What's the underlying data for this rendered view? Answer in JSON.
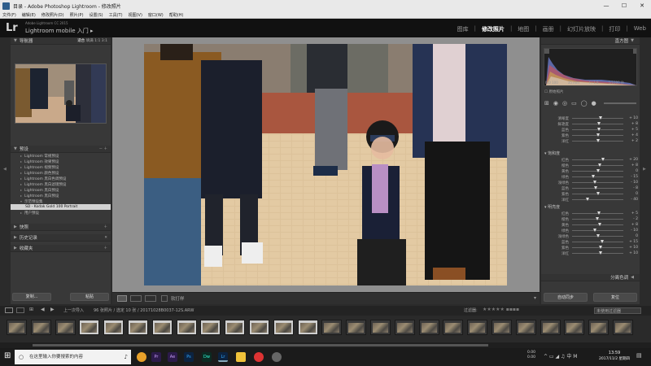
{
  "window": {
    "title": "目录 - Adobe Photoshop Lightroom - 修改照片",
    "controls": [
      "—",
      "☐",
      "✕"
    ]
  },
  "menu": [
    "文件(F)",
    "编辑(E)",
    "修改照片(D)",
    "照片(P)",
    "设置(S)",
    "工具(T)",
    "视图(V)",
    "窗口(W)",
    "帮助(H)"
  ],
  "identity": {
    "logo": "Lr",
    "product": "Adobe Lightroom CC 2015",
    "mobile": "Lightroom mobile 入门",
    "mobile_arrow": "▸"
  },
  "modules": [
    "图库",
    "修改照片",
    "地图",
    "画册",
    "幻灯片放映",
    "打印",
    "Web"
  ],
  "active_module": "修改照片",
  "left_panel": {
    "navigator": {
      "title": "导航器",
      "options": [
        "适合",
        "填满",
        "1:1",
        "3:1"
      ]
    },
    "presets": {
      "title": "预设",
      "items": [
        "Lightroom 常规预设",
        "Lightroom 效果预设",
        "Lightroom 视频预设",
        "Lightroom 颜色预设",
        "Lightroom 黑白色调预设",
        "Lightroom 黑白滤镜预设",
        "Lightroom 黑白预设",
        "Lightroom 黑白预设",
        "示范预设集"
      ],
      "selected": "SD - Kodak Gold 100 Portrait",
      "user": "用户预设"
    },
    "sections": [
      "快照",
      "历史记录",
      "收藏夹"
    ],
    "copy_label": "复制...",
    "paste_label": "粘贴"
  },
  "toolbar": {
    "softproof": "软打样"
  },
  "right_panel": {
    "histogram_title": "直方图",
    "histogram_info": [
      "ISO 100",
      "35 mm",
      "f / 1.8",
      "1/1000 秒"
    ],
    "original_label": "原始照片",
    "sliders_a": [
      {
        "label": "清晰度",
        "value": "+ 10",
        "pos": 0.55
      },
      {
        "label": "鲜艳度",
        "value": "+ 8",
        "pos": 0.53
      },
      {
        "label": "蓝色",
        "value": "+ 5",
        "pos": 0.52
      },
      {
        "label": "紫色",
        "value": "+ 4",
        "pos": 0.51
      },
      {
        "label": "洋红",
        "value": "+ 2",
        "pos": 0.51
      }
    ],
    "hue_title": "饱和度",
    "sliders_b": [
      {
        "label": "红色",
        "value": "+ 20",
        "pos": 0.6
      },
      {
        "label": "橙色",
        "value": "+ 8",
        "pos": 0.54
      },
      {
        "label": "黄色",
        "value": "0",
        "pos": 0.5
      },
      {
        "label": "绿色",
        "value": "- 15",
        "pos": 0.42
      },
      {
        "label": "浅绿色",
        "value": "- 10",
        "pos": 0.45
      },
      {
        "label": "蓝色",
        "value": "- 8",
        "pos": 0.46
      },
      {
        "label": "紫色",
        "value": "0",
        "pos": 0.5
      },
      {
        "label": "洋红",
        "value": "- 40",
        "pos": 0.3
      }
    ],
    "lum_title": "明亮度",
    "sliders_c": [
      {
        "label": "红色",
        "value": "+ 5",
        "pos": 0.53
      },
      {
        "label": "橙色",
        "value": "- 2",
        "pos": 0.49
      },
      {
        "label": "黄色",
        "value": "+ 8",
        "pos": 0.54
      },
      {
        "label": "绿色",
        "value": "- 10",
        "pos": 0.45
      },
      {
        "label": "浅绿色",
        "value": "0",
        "pos": 0.5
      },
      {
        "label": "蓝色",
        "value": "+ 15",
        "pos": 0.58
      },
      {
        "label": "紫色",
        "value": "+ 10",
        "pos": 0.55
      },
      {
        "label": "洋红",
        "value": "+ 10",
        "pos": 0.55
      }
    ],
    "split_toning": "分离色调",
    "sync_label": "自动同步",
    "reset_label": "复位"
  },
  "filmbar": {
    "nav_text": "上一次导入",
    "count_text": "96 张照片 / 选定 10 张 / 20171028B0037-12S.ARW",
    "filter_label": "过滤器:",
    "filter_value": "未使用过滤器"
  },
  "taskbar": {
    "search_placeholder": "在这里输入你要搜索的内容",
    "time": "13:59",
    "date": "2017/11/2 星期四",
    "net_up": "0.00",
    "net_down": "0.00"
  }
}
